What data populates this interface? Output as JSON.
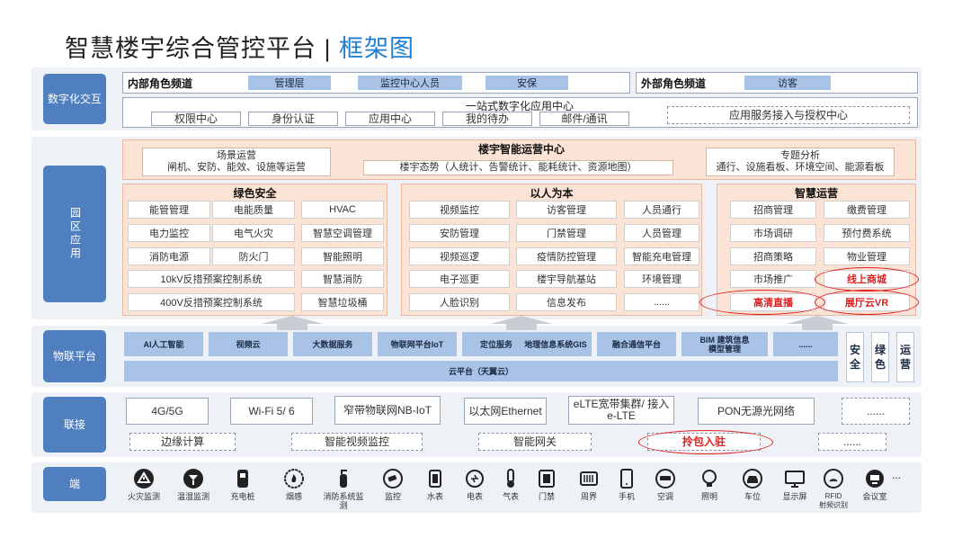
{
  "title": {
    "main": "智慧楼宇综合管控平台 | ",
    "highlight": "框架图"
  },
  "layers": {
    "digital": "数字化交互",
    "park": "园区应用",
    "iot": "物联平台",
    "connect": "联接",
    "end": "端"
  },
  "digital": {
    "internal_title": "内部角色频道",
    "internal_roles": [
      "管理层",
      "监控中心人员",
      "安保"
    ],
    "external_title": "外部角色频道",
    "external_roles": [
      "访客"
    ],
    "one_stop": "一站式数字化应用中心",
    "apps": [
      "权限中心",
      "身份认证",
      "应用中心",
      "我的待办",
      "邮件/通讯"
    ],
    "access": "应用服务接入与授权中心"
  },
  "ops": {
    "title": "楼宇智能运营中心",
    "scene_title": "场景运营",
    "scene_desc": "闸机、安防、能效、设施等运营",
    "situation": "楼宇态势（人统计、告警统计、能耗统计、资源地图）",
    "topic_title": "专题分析",
    "topic_desc": "通行、设施看板、环境空间、能源看板"
  },
  "green": {
    "title": "绿色安全",
    "rows": [
      [
        "能管管理",
        "电能质量",
        "HVAC"
      ],
      [
        "电力监控",
        "电气火灾",
        "智慧空调管理"
      ],
      [
        "消防电源",
        "防火门",
        "智能照明"
      ],
      [
        "10kV反措预案控制系统",
        "智慧消防"
      ],
      [
        "400V反措预案控制系统",
        "智慧垃圾桶"
      ]
    ]
  },
  "people": {
    "title": "以人为本",
    "rows": [
      [
        "视频监控",
        "访客管理",
        "人员通行"
      ],
      [
        "安防管理",
        "门禁管理",
        "人员管理"
      ],
      [
        "视频巡逻",
        "疫情防控管理",
        "智能充电管理"
      ],
      [
        "电子巡更",
        "楼宇导航基站",
        "环境管理"
      ],
      [
        "人脸识别",
        "信息发布",
        "......"
      ]
    ]
  },
  "smart": {
    "title": "智慧运营",
    "rows": [
      [
        "招商管理",
        "缴费管理"
      ],
      [
        "市场调研",
        "预付费系统"
      ],
      [
        "招商策略",
        "物业管理"
      ],
      [
        "市场推广",
        "线上商城"
      ],
      [
        "高清直播",
        "展厅云VR"
      ]
    ]
  },
  "iot": {
    "items": [
      "AI人工智能",
      "视频云",
      "大数据服务",
      "物联网平台IoT",
      "定位服务",
      "地理信息系统GIS",
      "融合通信平台",
      "BIM 建筑信息\n模型管理",
      "......"
    ],
    "cloud": "云平台（天翼云）",
    "side": [
      "安全",
      "绿色",
      "运营"
    ]
  },
  "connect": {
    "row1": [
      "4G/5G",
      "Wi-Fi 5/ 6",
      "窄带物联网NB-IoT",
      "以太网Ethernet",
      "eLTE宽带集群/ 接入e-LTE",
      "PON无源光网络",
      "......"
    ],
    "row2": [
      "边缘计算",
      "智能视频监控",
      "智能网关",
      "拎包入驻",
      "......"
    ]
  },
  "devices": {
    "items": [
      {
        "label": "火灾监测",
        "icon": "fire-alarm-icon"
      },
      {
        "label": "温湿监测",
        "icon": "thermometer-icon"
      },
      {
        "label": "充电桩",
        "icon": "charger-icon"
      },
      {
        "label": "烟感",
        "icon": "smoke-icon"
      },
      {
        "label": "消防系统监测",
        "icon": "extinguisher-icon"
      },
      {
        "label": "监控",
        "icon": "camera-icon"
      },
      {
        "label": "水表",
        "icon": "water-meter-icon"
      },
      {
        "label": "电表",
        "icon": "power-meter-icon"
      },
      {
        "label": "气表",
        "icon": "gas-meter-icon"
      },
      {
        "label": "门禁",
        "icon": "door-icon"
      },
      {
        "label": "周界",
        "icon": "fence-icon"
      },
      {
        "label": "手机",
        "icon": "phone-icon"
      },
      {
        "label": "空调",
        "icon": "ac-icon"
      },
      {
        "label": "照明",
        "icon": "bulb-icon"
      },
      {
        "label": "车位",
        "icon": "car-icon"
      },
      {
        "label": "显示屏",
        "icon": "monitor-icon"
      },
      {
        "label": "RFID\n射频识别",
        "icon": "rfid-icon"
      },
      {
        "label": "会议室",
        "icon": "meeting-icon"
      }
    ],
    "more": "..."
  },
  "colors": {
    "accent": "#1f7fd0",
    "layer": "#4f7fbf",
    "highlight_red": "#e02020",
    "peach": "#fbe4d6"
  }
}
